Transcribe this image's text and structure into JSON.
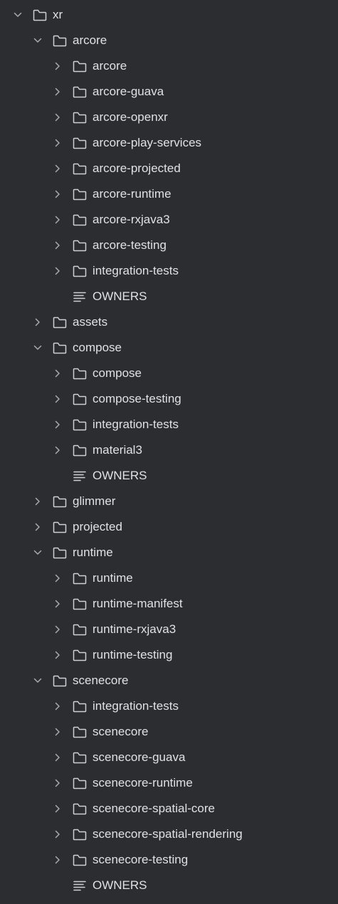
{
  "tree": [
    {
      "label": "xr",
      "depth": 0,
      "type": "folder",
      "expanded": true
    },
    {
      "label": "arcore",
      "depth": 1,
      "type": "folder",
      "expanded": true
    },
    {
      "label": "arcore",
      "depth": 2,
      "type": "folder",
      "expanded": false
    },
    {
      "label": "arcore-guava",
      "depth": 2,
      "type": "folder",
      "expanded": false
    },
    {
      "label": "arcore-openxr",
      "depth": 2,
      "type": "folder",
      "expanded": false
    },
    {
      "label": "arcore-play-services",
      "depth": 2,
      "type": "folder",
      "expanded": false
    },
    {
      "label": "arcore-projected",
      "depth": 2,
      "type": "folder",
      "expanded": false
    },
    {
      "label": "arcore-runtime",
      "depth": 2,
      "type": "folder",
      "expanded": false
    },
    {
      "label": "arcore-rxjava3",
      "depth": 2,
      "type": "folder",
      "expanded": false
    },
    {
      "label": "arcore-testing",
      "depth": 2,
      "type": "folder",
      "expanded": false
    },
    {
      "label": "integration-tests",
      "depth": 2,
      "type": "folder",
      "expanded": false
    },
    {
      "label": "OWNERS",
      "depth": 2,
      "type": "file"
    },
    {
      "label": "assets",
      "depth": 1,
      "type": "folder",
      "expanded": false
    },
    {
      "label": "compose",
      "depth": 1,
      "type": "folder",
      "expanded": true
    },
    {
      "label": "compose",
      "depth": 2,
      "type": "folder",
      "expanded": false
    },
    {
      "label": "compose-testing",
      "depth": 2,
      "type": "folder",
      "expanded": false
    },
    {
      "label": "integration-tests",
      "depth": 2,
      "type": "folder",
      "expanded": false
    },
    {
      "label": "material3",
      "depth": 2,
      "type": "folder",
      "expanded": false
    },
    {
      "label": "OWNERS",
      "depth": 2,
      "type": "file"
    },
    {
      "label": "glimmer",
      "depth": 1,
      "type": "folder",
      "expanded": false
    },
    {
      "label": "projected",
      "depth": 1,
      "type": "folder",
      "expanded": false
    },
    {
      "label": "runtime",
      "depth": 1,
      "type": "folder",
      "expanded": true
    },
    {
      "label": "runtime",
      "depth": 2,
      "type": "folder",
      "expanded": false
    },
    {
      "label": "runtime-manifest",
      "depth": 2,
      "type": "folder",
      "expanded": false
    },
    {
      "label": "runtime-rxjava3",
      "depth": 2,
      "type": "folder",
      "expanded": false
    },
    {
      "label": "runtime-testing",
      "depth": 2,
      "type": "folder",
      "expanded": false
    },
    {
      "label": "scenecore",
      "depth": 1,
      "type": "folder",
      "expanded": true
    },
    {
      "label": "integration-tests",
      "depth": 2,
      "type": "folder",
      "expanded": false
    },
    {
      "label": "scenecore",
      "depth": 2,
      "type": "folder",
      "expanded": false
    },
    {
      "label": "scenecore-guava",
      "depth": 2,
      "type": "folder",
      "expanded": false
    },
    {
      "label": "scenecore-runtime",
      "depth": 2,
      "type": "folder",
      "expanded": false
    },
    {
      "label": "scenecore-spatial-core",
      "depth": 2,
      "type": "folder",
      "expanded": false
    },
    {
      "label": "scenecore-spatial-rendering",
      "depth": 2,
      "type": "folder",
      "expanded": false
    },
    {
      "label": "scenecore-testing",
      "depth": 2,
      "type": "folder",
      "expanded": false
    },
    {
      "label": "OWNERS",
      "depth": 2,
      "type": "file"
    }
  ],
  "icons": {
    "folder": "folder-icon",
    "file": "text-file-icon",
    "expanded": "chevron-down-icon",
    "collapsed": "chevron-right-icon"
  },
  "colors": {
    "background": "#2b2d30",
    "text": "#dfe1e5",
    "icon": "#ced0d6",
    "chevron": "#a8abb0"
  }
}
